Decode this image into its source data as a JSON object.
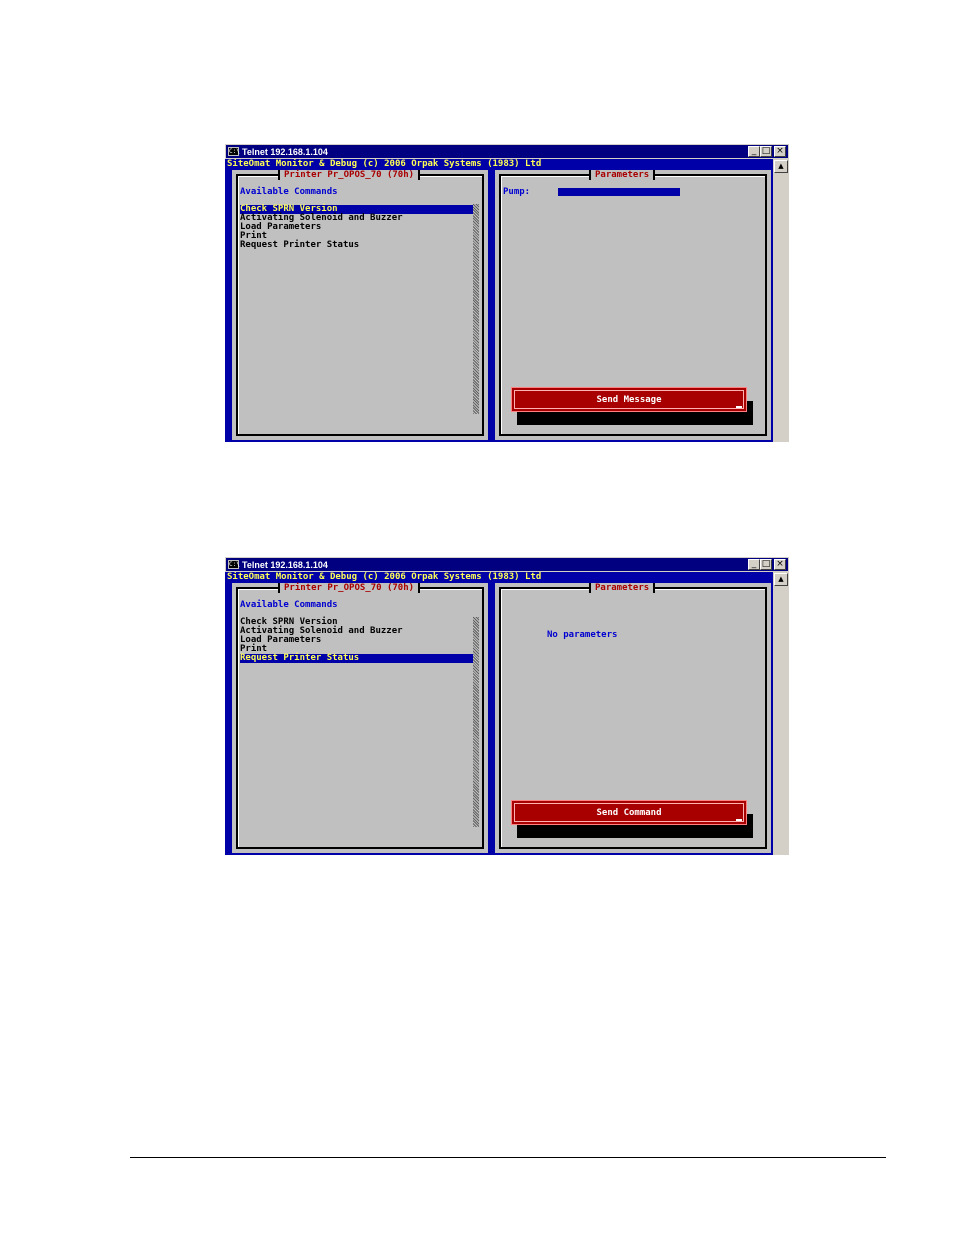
{
  "screenshots": [
    {
      "window_title": "Telnet 192.168.1.104",
      "console_header": "SiteOmat Monitor & Debug (c) 2006 Orpak Systems (1983) Ltd",
      "left_panel_title": "Printer Pr_OPOS_70 (70h)",
      "available_commands_label": "Available Commands",
      "commands": [
        "Check SPRN Version",
        "Activating Solenoid and Buzzer",
        "Load Parameters",
        "Print",
        "Request Printer Status"
      ],
      "selected_command": "Check SPRN Version",
      "right_panel_title": "Parameters",
      "pump_label": "Pump:",
      "send_button_label": "Send Message"
    },
    {
      "window_title": "Telnet 192.168.1.104",
      "console_header": "SiteOmat Monitor & Debug (c) 2006 Orpak Systems (1983) Ltd",
      "left_panel_title": "Printer Pr_OPOS_70 (70h)",
      "available_commands_label": "Available Commands",
      "commands": [
        "Check SPRN Version",
        "Activating Solenoid and Buzzer",
        "Load Parameters",
        "Print",
        "Request Printer Status"
      ],
      "selected_command": "Request Printer Status",
      "right_panel_title": "Parameters",
      "no_parameters_text": "No parameters",
      "send_button_label": "Send Command"
    }
  ],
  "colors": {
    "console_blue": "#0000a8",
    "header_yellow": "#ffff55",
    "panel_gray": "#c0c0c0",
    "title_red": "#a80000",
    "button_red": "#a80000"
  },
  "icons": [
    "console-app-icon",
    "minimize-icon",
    "maximize-icon",
    "close-icon",
    "scroll-up-arrow-icon"
  ]
}
